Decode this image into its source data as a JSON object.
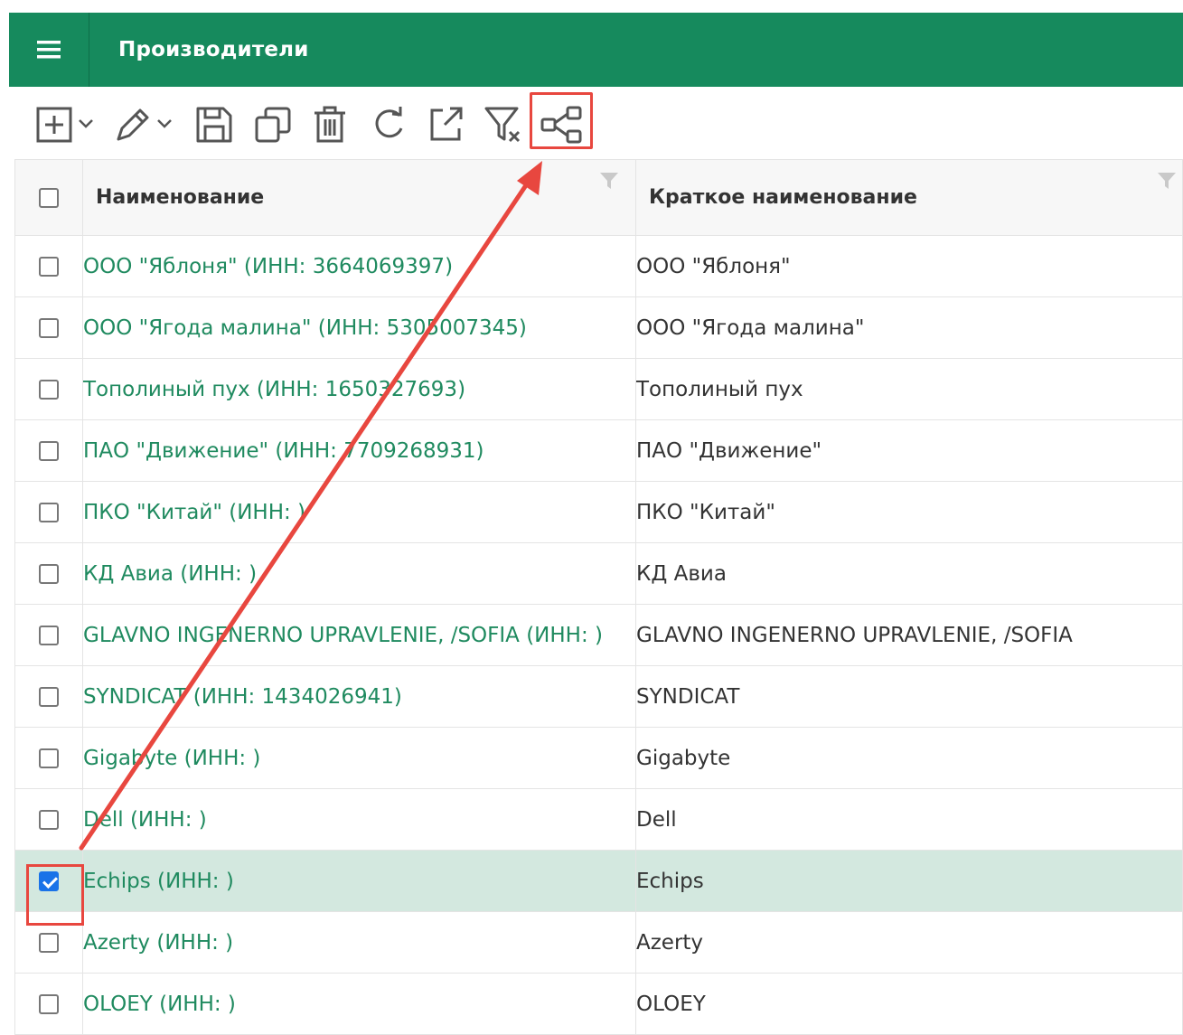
{
  "header": {
    "title": "Производители"
  },
  "toolbar": {
    "buttons": [
      {
        "name": "add-button",
        "icon": "plus-square-icon"
      },
      {
        "name": "edit-button",
        "icon": "pencil-icon"
      },
      {
        "name": "save-button",
        "icon": "floppy-disk-icon"
      },
      {
        "name": "copy-button",
        "icon": "copy-icon"
      },
      {
        "name": "delete-button",
        "icon": "trash-icon"
      },
      {
        "name": "refresh-button",
        "icon": "refresh-icon"
      },
      {
        "name": "export-button",
        "icon": "external-link-icon"
      },
      {
        "name": "clear-filter-button",
        "icon": "filter-clear-icon"
      },
      {
        "name": "relations-button",
        "icon": "share-nodes-icon"
      }
    ]
  },
  "table": {
    "columns": [
      "Наименование",
      "Краткое наименование"
    ],
    "rows": [
      {
        "name": "ООО \"Яблоня\" (ИНН: 3664069397)",
        "short": "ООО \"Яблоня\"",
        "checked": false
      },
      {
        "name": "ООО \"Ягода малина\" (ИНН: 5305007345)",
        "short": "ООО \"Ягода малина\"",
        "checked": false
      },
      {
        "name": "Тополиный пух (ИНН: 1650327693)",
        "short": "Тополиный пух",
        "checked": false
      },
      {
        "name": "ПАО \"Движение\" (ИНН: 7709268931)",
        "short": "ПАО \"Движение\"",
        "checked": false
      },
      {
        "name": "ПКО \"Китай\" (ИНН: )",
        "short": "ПКО \"Китай\"",
        "checked": false
      },
      {
        "name": "КД Авиа (ИНН: )",
        "short": "КД Авиа",
        "checked": false
      },
      {
        "name": "GLAVNO INGENERNO UPRAVLENIE, /SOFIA (ИНН: )",
        "short": "GLAVNO INGENERNO UPRAVLENIE, /SOFIA",
        "checked": false
      },
      {
        "name": "SYNDICAT (ИНН: 1434026941)",
        "short": "SYNDICAT",
        "checked": false
      },
      {
        "name": "Gigabyte (ИНН: )",
        "short": "Gigabyte",
        "checked": false
      },
      {
        "name": "Dell (ИНН: )",
        "short": "Dell",
        "checked": false
      },
      {
        "name": "Echips (ИНН: )",
        "short": "Echips",
        "checked": true
      },
      {
        "name": "Azerty (ИНН: )",
        "short": "Azerty",
        "checked": false
      },
      {
        "name": "OLOEY (ИНН: )",
        "short": "OLOEY",
        "checked": false
      }
    ]
  },
  "colors": {
    "header_bg": "#168a5d",
    "link_text": "#1f8a5f",
    "selected_row": "#d3e8df",
    "annotation": "#e8473f",
    "checkbox_checked": "#1a73e8"
  }
}
